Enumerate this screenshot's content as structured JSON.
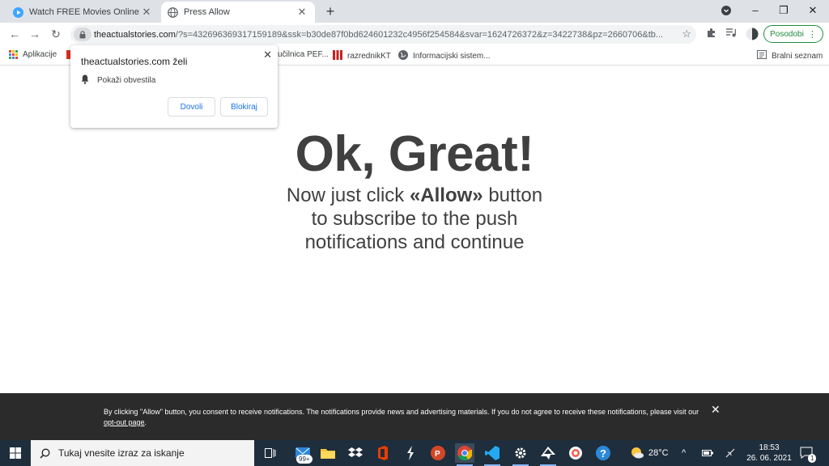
{
  "browser": {
    "tabs": [
      {
        "title": "Watch FREE Movies Online & Tv S",
        "active": false,
        "icon": "play-circle-icon"
      },
      {
        "title": "Press Allow",
        "active": true,
        "icon": "globe-icon"
      }
    ],
    "address": {
      "domain": "theactualstories.com",
      "path": "/?s=432696369317159189&ssk=b30de87f0bd624601232c4956f254584&svar=1624726372&z=3422738&pz=2660706&tb..."
    },
    "update_button": "Posodobi",
    "bookmarks": {
      "apps_label": "Aplikacije",
      "items": [
        "učilnica PEF...",
        "razrednikKT",
        "Informacijski sistem..."
      ],
      "reading_list": "Bralni seznam"
    }
  },
  "permission_popup": {
    "title": "theactualstories.com želi",
    "request": "Pokaži obvestila",
    "allow_label": "Dovoli",
    "block_label": "Blokiraj"
  },
  "page": {
    "headline": "Ok, Great!",
    "line1_before": "Now just click ",
    "line1_bold": "«Allow»",
    "line1_after": " button",
    "line2": "to subscribe to the push",
    "line3": "notifications and continue"
  },
  "consent": {
    "text": "By clicking \"Allow\" button, you consent to receive notifications. The notifications provide news and advertising materials. If you do not agree to receive these notifications, please visit our ",
    "link": "opt-out page",
    "end": "."
  },
  "taskbar": {
    "search_placeholder": "Tukaj vnesite izraz za iskanje",
    "mail_badge": "99+",
    "weather": "28°C",
    "time": "18:53",
    "date": "26. 06. 2021",
    "notification_count": "1"
  },
  "colors": {
    "accent": "#1a73e8",
    "update_green": "#1e8e3e",
    "headline": "#404040",
    "taskbar": "#1f2e3c",
    "consent_bar": "#2b2b2b"
  }
}
